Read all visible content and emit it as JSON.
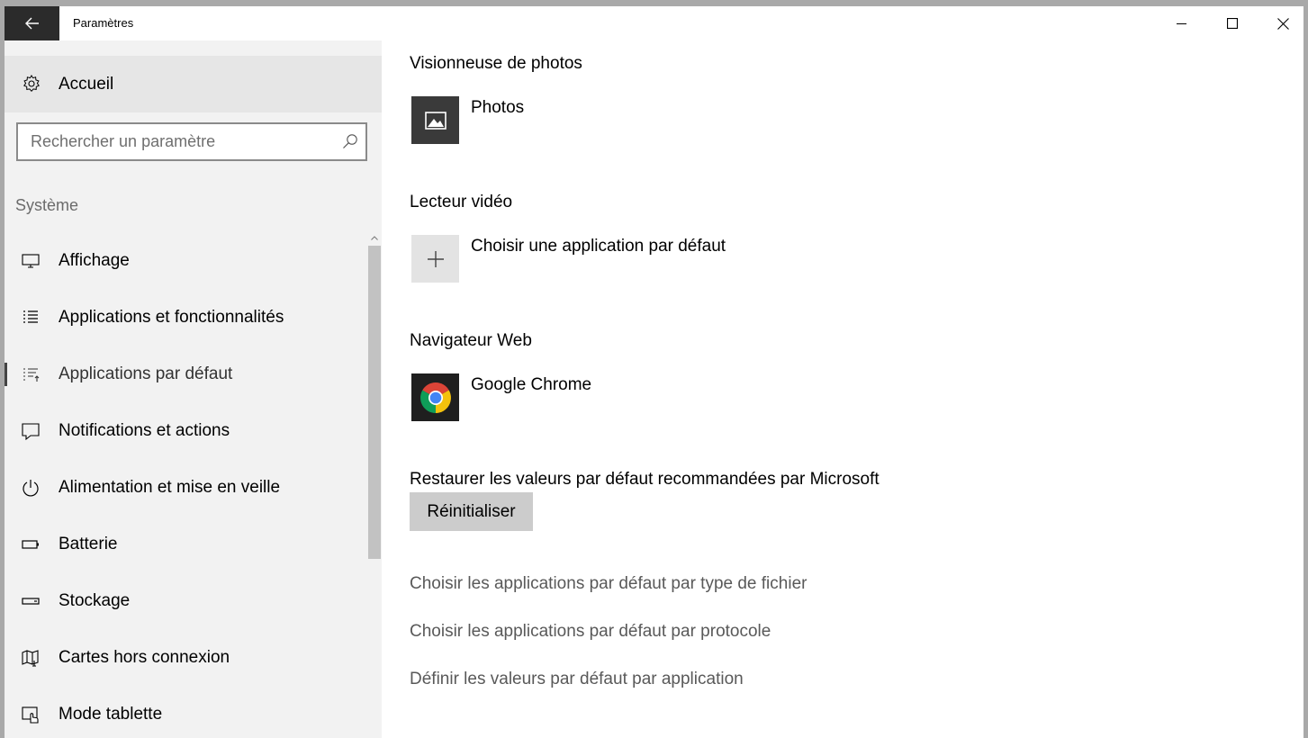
{
  "window": {
    "title": "Paramètres",
    "controls": {
      "minimize": "—",
      "maximize": "☐",
      "close": "✕"
    }
  },
  "sidebar": {
    "home_label": "Accueil",
    "search_placeholder": "Rechercher un paramètre",
    "section": "Système",
    "items": [
      {
        "label": "Affichage",
        "icon": "monitor-icon"
      },
      {
        "label": "Applications et fonctionnalités",
        "icon": "list-icon"
      },
      {
        "label": "Applications par défaut",
        "icon": "default-apps-icon",
        "active": true
      },
      {
        "label": "Notifications et actions",
        "icon": "notification-icon"
      },
      {
        "label": "Alimentation et mise en veille",
        "icon": "power-icon"
      },
      {
        "label": "Batterie",
        "icon": "battery-icon"
      },
      {
        "label": "Stockage",
        "icon": "storage-icon"
      },
      {
        "label": "Cartes hors connexion",
        "icon": "map-icon"
      },
      {
        "label": "Mode tablette",
        "icon": "tablet-mode-icon"
      }
    ]
  },
  "main": {
    "photo_viewer": {
      "heading": "Visionneuse de photos",
      "app": "Photos"
    },
    "video_player": {
      "heading": "Lecteur vidéo",
      "app": "Choisir une application par défaut"
    },
    "web_browser": {
      "heading": "Navigateur Web",
      "app": "Google Chrome"
    },
    "restore": {
      "heading": "Restaurer les valeurs par défaut recommandées par Microsoft",
      "button": "Réinitialiser"
    },
    "links": [
      "Choisir les applications par défaut par type de fichier",
      "Choisir les applications par défaut par protocole",
      "Définir les valeurs par défaut par application"
    ]
  },
  "colors": {
    "sidebar_bg": "#f2f2f2",
    "home_highlight": "#e6e6e6",
    "back_button_bg": "#2b2b2b",
    "photos_tile": "#3a3a3a",
    "add_tile": "#e3e3e3",
    "chrome_tile": "#1f1f1f",
    "reset_button_bg": "#cccccc",
    "link_text": "#595959"
  }
}
